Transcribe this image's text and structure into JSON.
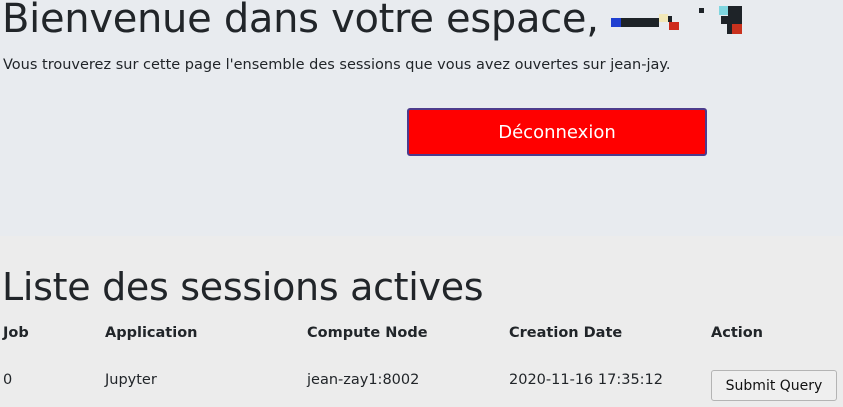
{
  "header": {
    "welcome": "Bienvenue dans votre espace,",
    "intro": "Vous trouverez sur cette page l'ensemble des sessions que vous avez ouvertes sur jean-jay.",
    "logout_label": "Déconnexion"
  },
  "sessions": {
    "title": "Liste des sessions actives",
    "columns": [
      "Job",
      "Application",
      "Compute Node",
      "Creation Date",
      "Action"
    ],
    "rows": [
      {
        "job": "0",
        "application": "Jupyter",
        "node": "jean-zay1:8002",
        "date": "2020-11-16 17:35:12",
        "action": "Submit Query"
      }
    ]
  },
  "colors": {
    "logout_bg": "#ff0000",
    "top_bg": "#e8ebef",
    "page_bg": "#ececec"
  }
}
